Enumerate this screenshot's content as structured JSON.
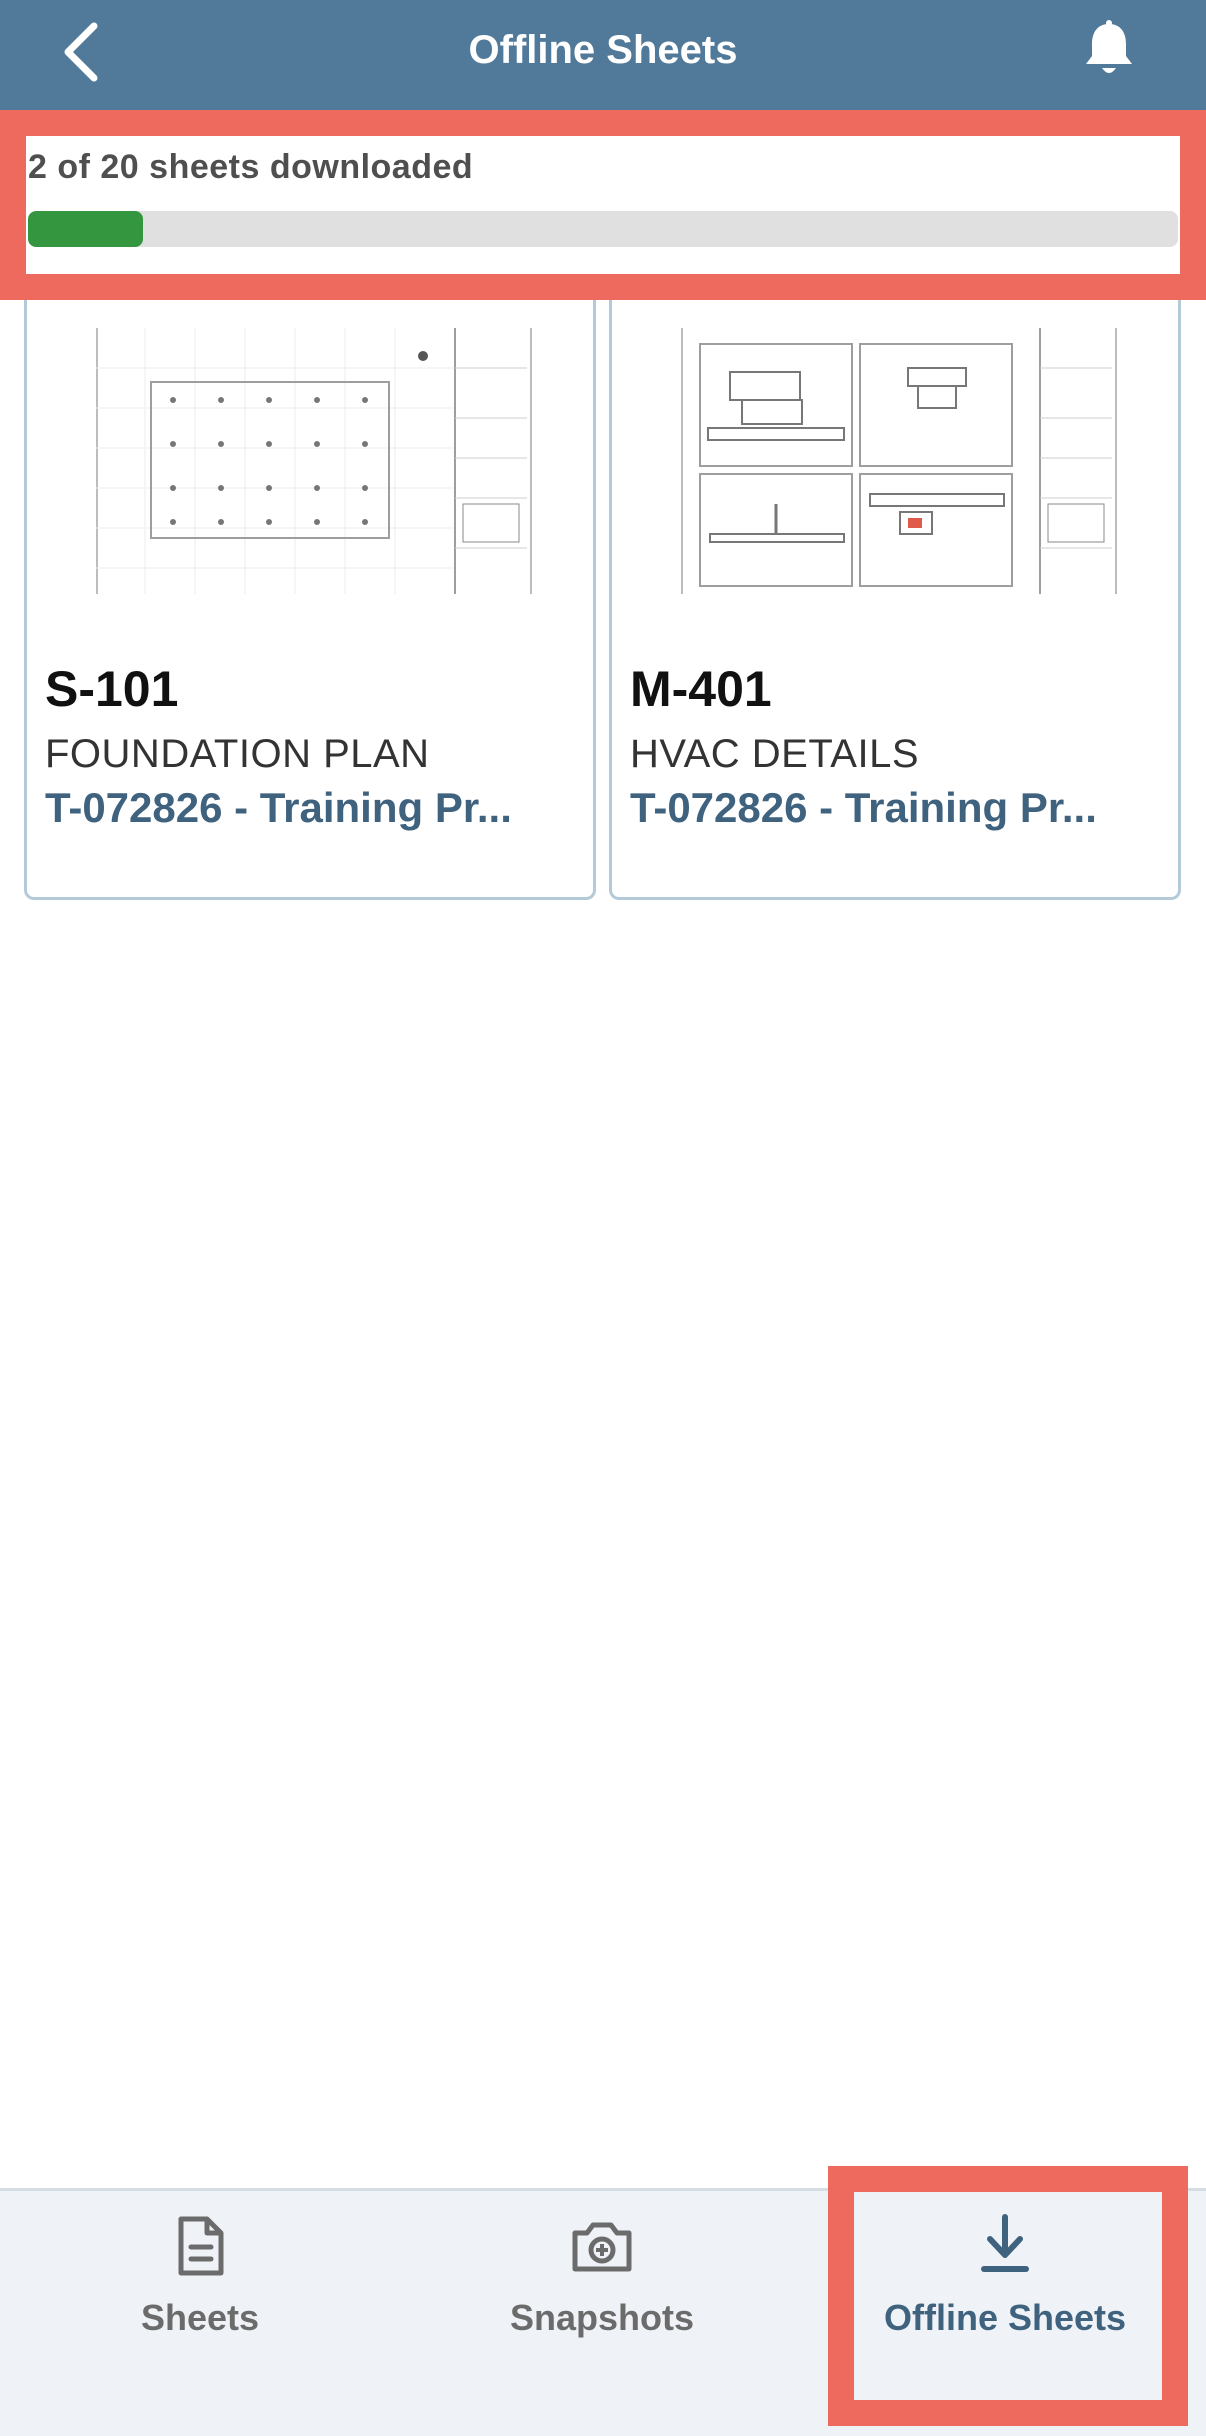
{
  "header": {
    "title": "Offline Sheets",
    "back_icon": "chevron-left-icon",
    "bell_icon": "bell-icon"
  },
  "progress": {
    "label": "2 of 20 sheets downloaded",
    "downloaded": 2,
    "total": 20,
    "fill_color": "#34963e"
  },
  "sheets": [
    {
      "number": "S-101",
      "name": "FOUNDATION PLAN",
      "project": "T-072826 - Training Pr..."
    },
    {
      "number": "M-401",
      "name": "HVAC DETAILS",
      "project": "T-072826 - Training Pr..."
    }
  ],
  "tabbar": {
    "tabs": [
      {
        "label": "Sheets",
        "icon": "document-icon",
        "active": false
      },
      {
        "label": "Snapshots",
        "icon": "camera-icon",
        "active": false
      },
      {
        "label": "Offline Sheets",
        "icon": "download-icon",
        "active": true
      }
    ]
  },
  "colors": {
    "header_bg": "#517999",
    "highlight": "#ef6a5e",
    "accent_text": "#3f627f"
  }
}
